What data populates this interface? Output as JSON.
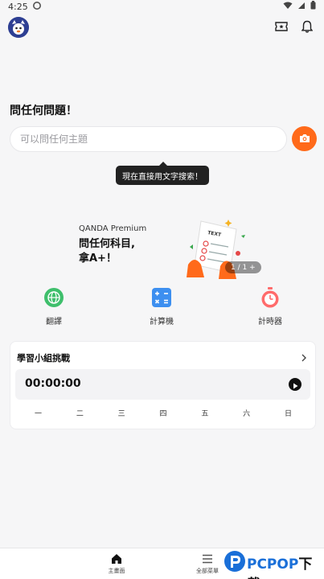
{
  "status_bar": {
    "time": "4:25"
  },
  "search": {
    "title": "問任何問題！",
    "placeholder": "可以問任何主題",
    "tooltip": "現在直接用文字搜索！"
  },
  "banner": {
    "brand": "QANDA Premium",
    "line1": "問任何科目,",
    "line2": "拿A+！",
    "page_indicator": "1 / 1 +",
    "art_text": "TEXT"
  },
  "tools": [
    {
      "label": "翻譯",
      "icon": "globe-icon"
    },
    {
      "label": "計算機",
      "icon": "calculator-icon"
    },
    {
      "label": "計時器",
      "icon": "stopwatch-icon"
    }
  ],
  "study_card": {
    "title": "學習小組挑戰",
    "timer": "00:00:00",
    "days": [
      "一",
      "二",
      "三",
      "四",
      "五",
      "六",
      "日"
    ]
  },
  "bottom_nav": [
    {
      "label": "主畫面",
      "icon": "home-icon"
    },
    {
      "label": "全部菜單",
      "icon": "menu-icon"
    }
  ],
  "watermark": {
    "brand": "PCPOP",
    "suffix": "下载"
  },
  "colors": {
    "accent": "#ff6a1a",
    "background": "#f6f6f7",
    "watermark": "#1a6fd8"
  }
}
